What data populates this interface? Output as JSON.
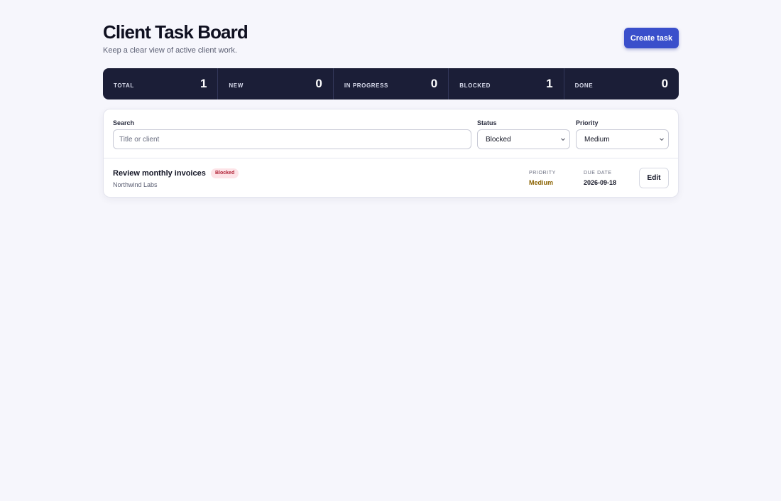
{
  "header": {
    "title": "Client Task Board",
    "subtitle": "Keep a clear view of active client work.",
    "create_label": "Create task"
  },
  "stats": [
    {
      "label": "TOTAL",
      "value": "1"
    },
    {
      "label": "NEW",
      "value": "0"
    },
    {
      "label": "IN PROGRESS",
      "value": "0"
    },
    {
      "label": "BLOCKED",
      "value": "1"
    },
    {
      "label": "DONE",
      "value": "0"
    }
  ],
  "filters": {
    "search_label": "Search",
    "search_placeholder": "Title or client",
    "status_label": "Status",
    "status_value": "Blocked",
    "priority_label": "Priority",
    "priority_value": "Medium"
  },
  "tasks": [
    {
      "title": "Review monthly invoices",
      "status": "Blocked",
      "client": "Northwind Labs",
      "priority_label": "PRIORITY",
      "priority": "Medium",
      "due_label": "DUE DATE",
      "due_date": "2026-09-18",
      "edit_label": "Edit"
    }
  ],
  "colors": {
    "accent": "#3a4fcb",
    "stats_bg": "#1b1e37",
    "blocked_badge_bg": "#fde3e7",
    "blocked_badge_text": "#b02236",
    "priority_medium": "#8a6200"
  },
  "icons": {
    "select_chevron": "chevron-down-icon"
  }
}
